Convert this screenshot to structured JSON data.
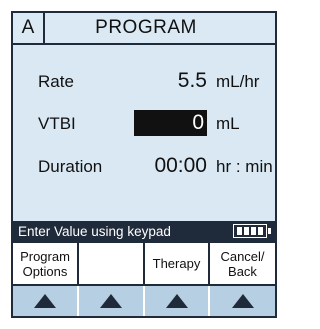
{
  "header": {
    "channel": "A",
    "title": "PROGRAM"
  },
  "fields": {
    "rate": {
      "label": "Rate",
      "value": "5.5",
      "unit": "mL/hr"
    },
    "vtbi": {
      "label": "VTBI",
      "value": "0",
      "unit": "mL"
    },
    "duration": {
      "label": "Duration",
      "value": "00:00",
      "unit": "hr : min"
    }
  },
  "status": {
    "message": "Enter Value using keypad",
    "battery_icon": "battery-full-icon"
  },
  "softkeys": [
    {
      "label": "Program\nOptions"
    },
    {
      "label": ""
    },
    {
      "label": "Therapy"
    },
    {
      "label": "Cancel/\nBack"
    }
  ],
  "colors": {
    "screen_bg": "#d9e8f3",
    "dark": "#1f2b3a",
    "arrow_bar": "#b7cfe2"
  }
}
